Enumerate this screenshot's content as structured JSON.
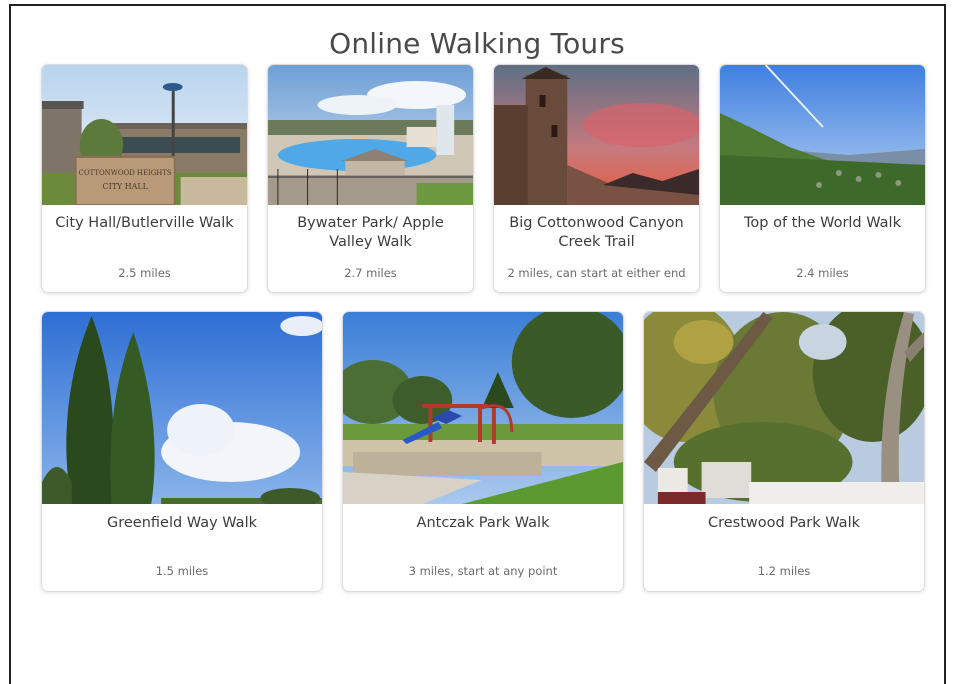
{
  "page": {
    "title": "Online Walking Tours"
  },
  "tours": [
    {
      "title": "City Hall/Butlerville Walk",
      "distance": "2.5 miles",
      "image_icon": "city-hall-photo"
    },
    {
      "title": "Bywater Park/ Apple Valley Walk",
      "distance": "2.7 miles",
      "image_icon": "pool-park-photo"
    },
    {
      "title": "Big Cottonwood Canyon Creek Trail",
      "distance": "2 miles, can start at either end",
      "image_icon": "stone-tower-photo"
    },
    {
      "title": "Top of the World Walk",
      "distance": "2.4 miles",
      "image_icon": "mountain-valley-photo"
    },
    {
      "title": "Greenfield Way Walk",
      "distance": "1.5 miles",
      "image_icon": "cypress-trees-photo"
    },
    {
      "title": "Antczak Park Walk",
      "distance": "3 miles, start at any point",
      "image_icon": "playground-photo"
    },
    {
      "title": "Crestwood Park Walk",
      "distance": "1.2 miles",
      "image_icon": "forest-sign-photo"
    }
  ],
  "sign_text": {
    "city_hall_line1": "COTTONWOOD HEIGHTS",
    "city_hall_line2": "CITY HALL"
  }
}
